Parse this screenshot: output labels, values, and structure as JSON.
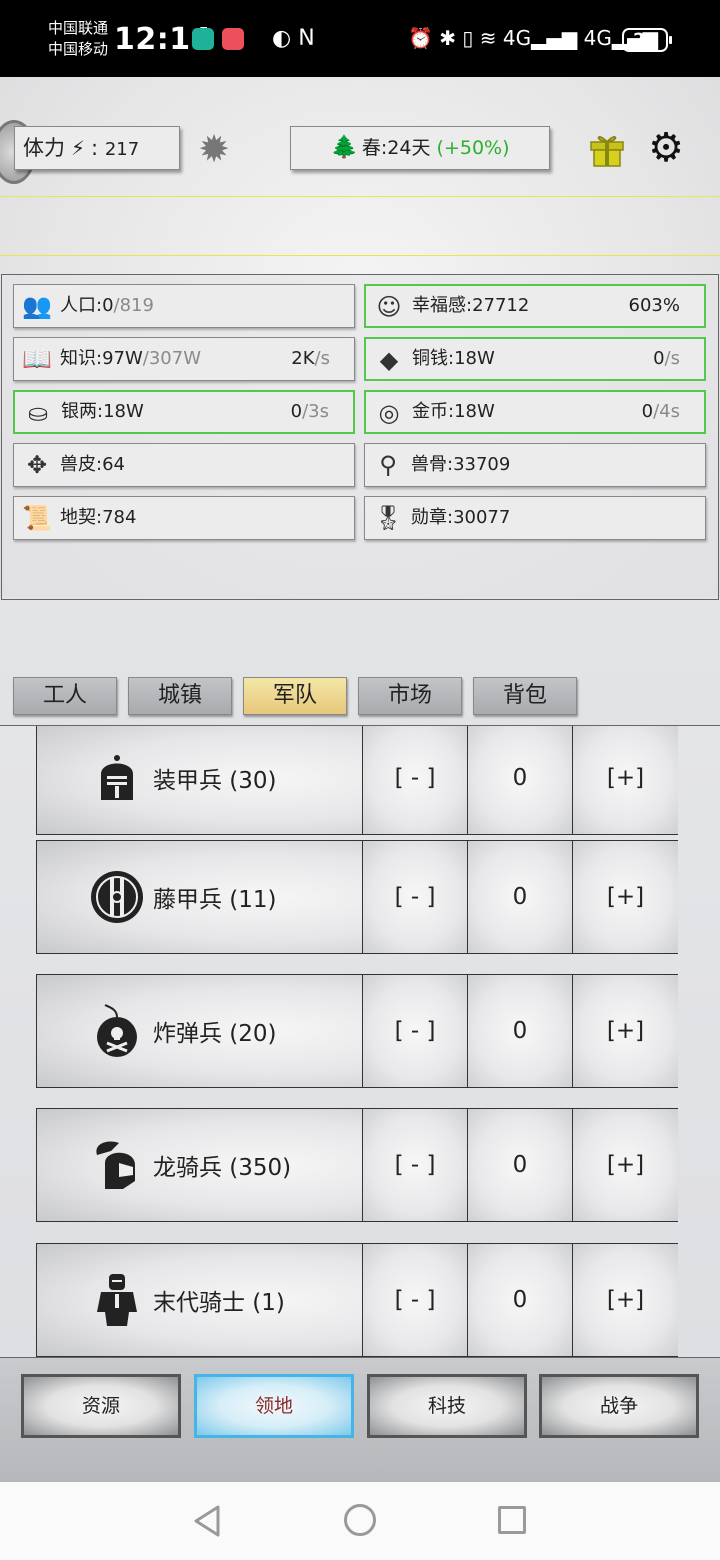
{
  "status_bar": {
    "carrier1": "中国联通",
    "carrier2": "中国移动",
    "time": "12:14",
    "network": "4G",
    "battery": "23"
  },
  "header": {
    "stamina_label": "体力",
    "stamina_sep": ":",
    "stamina_value": "217",
    "season_label": "春:24天",
    "season_bonus": "(+50%)"
  },
  "resources": [
    {
      "id": "population",
      "icon": "people-icon",
      "glyph": "👥",
      "name": "人口:0",
      "max": "/819",
      "rate": "",
      "unit": "",
      "highlight": false
    },
    {
      "id": "happiness",
      "icon": "smile-icon",
      "glyph": "☺",
      "name": "幸福感:27712",
      "max": "",
      "rate": "603%",
      "unit": "",
      "highlight": true
    },
    {
      "id": "knowledge",
      "icon": "book-icon",
      "glyph": "📖",
      "name": "知识:97W",
      "max": "/307W",
      "rate": "2K",
      "unit": "/s",
      "highlight": false
    },
    {
      "id": "copper",
      "icon": "copper-coin-icon",
      "glyph": "◆",
      "name": "铜钱:18W",
      "max": "",
      "rate": "0",
      "unit": "/s",
      "highlight": true
    },
    {
      "id": "silver",
      "icon": "silver-ingot-icon",
      "glyph": "⛀",
      "name": "银两:18W",
      "max": "",
      "rate": "0",
      "unit": "/3s",
      "highlight": true
    },
    {
      "id": "gold",
      "icon": "gold-coin-icon",
      "glyph": "◎",
      "name": "金币:18W",
      "max": "",
      "rate": "0",
      "unit": "/4s",
      "highlight": true
    },
    {
      "id": "hide",
      "icon": "hide-icon",
      "glyph": "✥",
      "name": "兽皮:64",
      "max": "",
      "rate": "",
      "unit": "",
      "highlight": false
    },
    {
      "id": "bone",
      "icon": "bone-icon",
      "glyph": "⚲",
      "name": "兽骨:33709",
      "max": "",
      "rate": "",
      "unit": "",
      "highlight": false
    },
    {
      "id": "deed",
      "icon": "scroll-icon",
      "glyph": "📜",
      "name": "地契:784",
      "max": "",
      "rate": "",
      "unit": "",
      "highlight": false
    },
    {
      "id": "medal",
      "icon": "medal-icon",
      "glyph": "🎖",
      "name": "勋章:30077",
      "max": "",
      "rate": "",
      "unit": "",
      "highlight": false
    }
  ],
  "tabs": [
    {
      "id": "workers",
      "label": "工人",
      "active": false
    },
    {
      "id": "town",
      "label": "城镇",
      "active": false
    },
    {
      "id": "army",
      "label": "军队",
      "active": true
    },
    {
      "id": "market",
      "label": "市场",
      "active": false
    },
    {
      "id": "bag",
      "label": "背包",
      "active": false
    }
  ],
  "units": [
    {
      "id": "armored",
      "name": "装甲兵 (30)",
      "icon": "knight-helmet-icon",
      "count": "0"
    },
    {
      "id": "rattan",
      "name": "藤甲兵 (11)",
      "icon": "round-shield-icon",
      "count": "0"
    },
    {
      "id": "bomber",
      "name": "炸弹兵 (20)",
      "icon": "bomb-icon",
      "count": "0"
    },
    {
      "id": "dragoon",
      "name": "龙骑兵 (350)",
      "icon": "plumed-helmet-icon",
      "count": "0"
    },
    {
      "id": "lastknight",
      "name": "末代骑士 (1)",
      "icon": "armored-knight-icon",
      "count": "0"
    }
  ],
  "controls": {
    "minus": "[ - ]",
    "plus": "[+]"
  },
  "bottom_nav": [
    {
      "id": "resources",
      "label": "资源",
      "active": false
    },
    {
      "id": "territory",
      "label": "领地",
      "active": true
    },
    {
      "id": "tech",
      "label": "科技",
      "active": false
    },
    {
      "id": "war",
      "label": "战争",
      "active": false
    }
  ],
  "colors": {
    "accent_green": "#2db02d",
    "highlight_border": "#52c94a",
    "active_tab": "#e8c77c",
    "active_nav": "#46b4e6"
  }
}
